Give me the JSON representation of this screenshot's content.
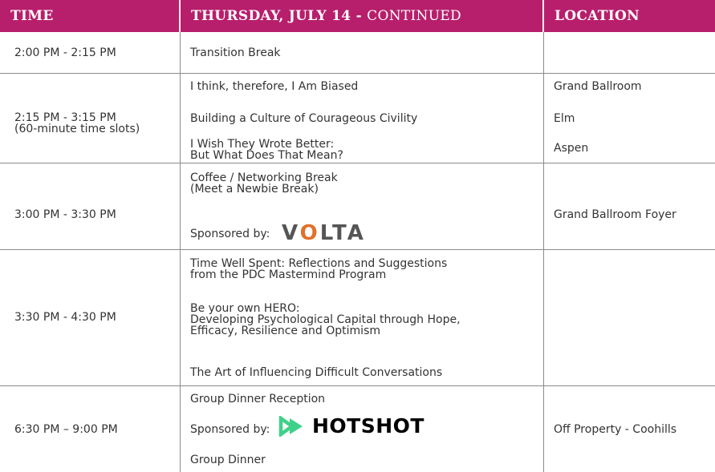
{
  "header": {
    "time": "TIME",
    "day": "THURSDAY, JULY 14 -",
    "day_suffix": "CONTINUED",
    "location": "LOCATION"
  },
  "colors": {
    "header_bg": "#b71f6c",
    "volta_accent": "#e0712b",
    "hotshot_green": "#3fd18a"
  },
  "rows": [
    {
      "time": "2:00 PM - 2:15 PM",
      "sessions": [
        "Transition Break"
      ],
      "locations": []
    },
    {
      "time": "2:15 PM - 3:15 PM\n(60-minute time slots)",
      "sessions": [
        "I think, therefore, I Am Biased",
        "Building a Culture of Courageous Civility",
        "I Wish They Wrote Better:\nBut What Does That Mean?"
      ],
      "locations": [
        "Grand Ballroom",
        "Elm",
        "Aspen"
      ]
    },
    {
      "time": "3:00 PM - 3:30 PM",
      "sessions": [
        "Coffee / Networking Break\n(Meet a Newbie Break)"
      ],
      "sponsor_label": "Sponsored by:",
      "sponsor_logo": {
        "name": "VOLTA",
        "letters": [
          "V",
          "O",
          "LTA"
        ]
      },
      "locations": [
        "Grand Ballroom Foyer"
      ]
    },
    {
      "time": "3:30 PM - 4:30 PM",
      "sessions": [
        "Time Well Spent: Reflections and Suggestions\nfrom the PDC Mastermind Program",
        "Be your own HERO:\nDeveloping Psychological Capital through Hope,\nEfficacy, Resilience and Optimism",
        "The Art of Influencing Difficult Conversations"
      ],
      "locations": []
    },
    {
      "time": "6:30 PM – 9:00 PM",
      "sessions": [
        "Group Dinner Reception",
        "Group Dinner"
      ],
      "sponsor_label": "Sponsored by:",
      "sponsor_logo": {
        "name": "HOTSHOT",
        "icon": "play-icon"
      },
      "locations": [
        "Off Property - Coohills"
      ]
    }
  ]
}
